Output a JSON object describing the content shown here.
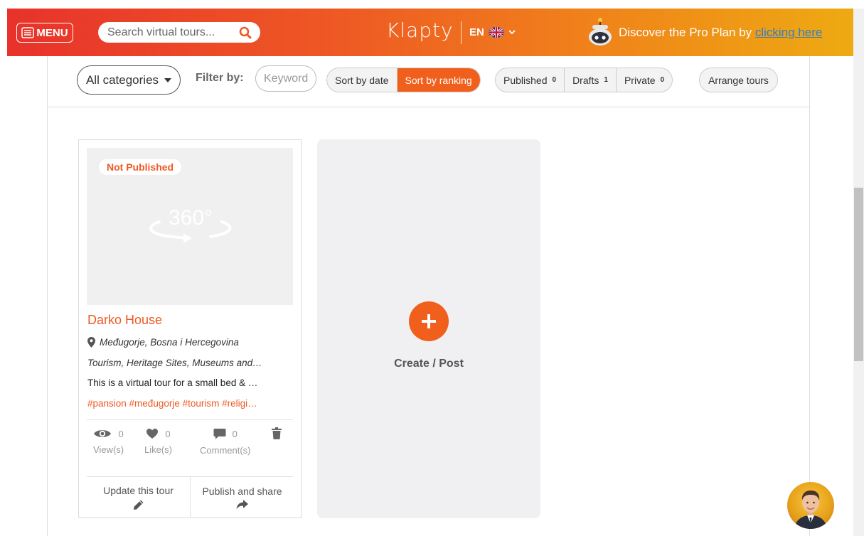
{
  "header": {
    "menu_label": "MENU",
    "search_placeholder": "Search virtual tours...",
    "logo": "Klapty",
    "language": "EN",
    "promo_text": "Discover the Pro Plan by",
    "promo_link": "clicking here",
    "colors": {
      "gradient_start": "#e8322b",
      "gradient_end": "#eeaa12",
      "link": "#2f7fc9"
    }
  },
  "filters": {
    "category_label": "All categories",
    "filter_by_label": "Filter by:",
    "keyword_placeholder": "Keyword",
    "sort_options": [
      {
        "label": "Sort by date",
        "active": false
      },
      {
        "label": "Sort by ranking",
        "active": true
      }
    ],
    "status_options": [
      {
        "label": "Published",
        "count": "0"
      },
      {
        "label": "Drafts",
        "count": "1"
      },
      {
        "label": "Private",
        "count": "0"
      }
    ],
    "arrange_label": "Arrange tours",
    "accent": "#f0601c"
  },
  "tour": {
    "badge": "Not Published",
    "title": "Darko House",
    "location": "Međugorje, Bosna i Hercegovina",
    "categories": "Tourism, Heritage Sites, Museums and…",
    "description": "This is a virtual tour for a small bed & …",
    "tags": "#pansion #međugorje #tourism #religi…",
    "stats": [
      {
        "icon": "eye-icon",
        "value": "0",
        "label": "View(s)"
      },
      {
        "icon": "heart-icon",
        "value": "0",
        "label": "Like(s)"
      },
      {
        "icon": "comment-icon",
        "value": "0",
        "label": "Comment(s)"
      }
    ],
    "actions": [
      {
        "label": "Update this tour",
        "icon": "pencil-icon"
      },
      {
        "label": "Publish and share",
        "icon": "share-icon"
      }
    ]
  },
  "create": {
    "label": "Create / Post"
  }
}
